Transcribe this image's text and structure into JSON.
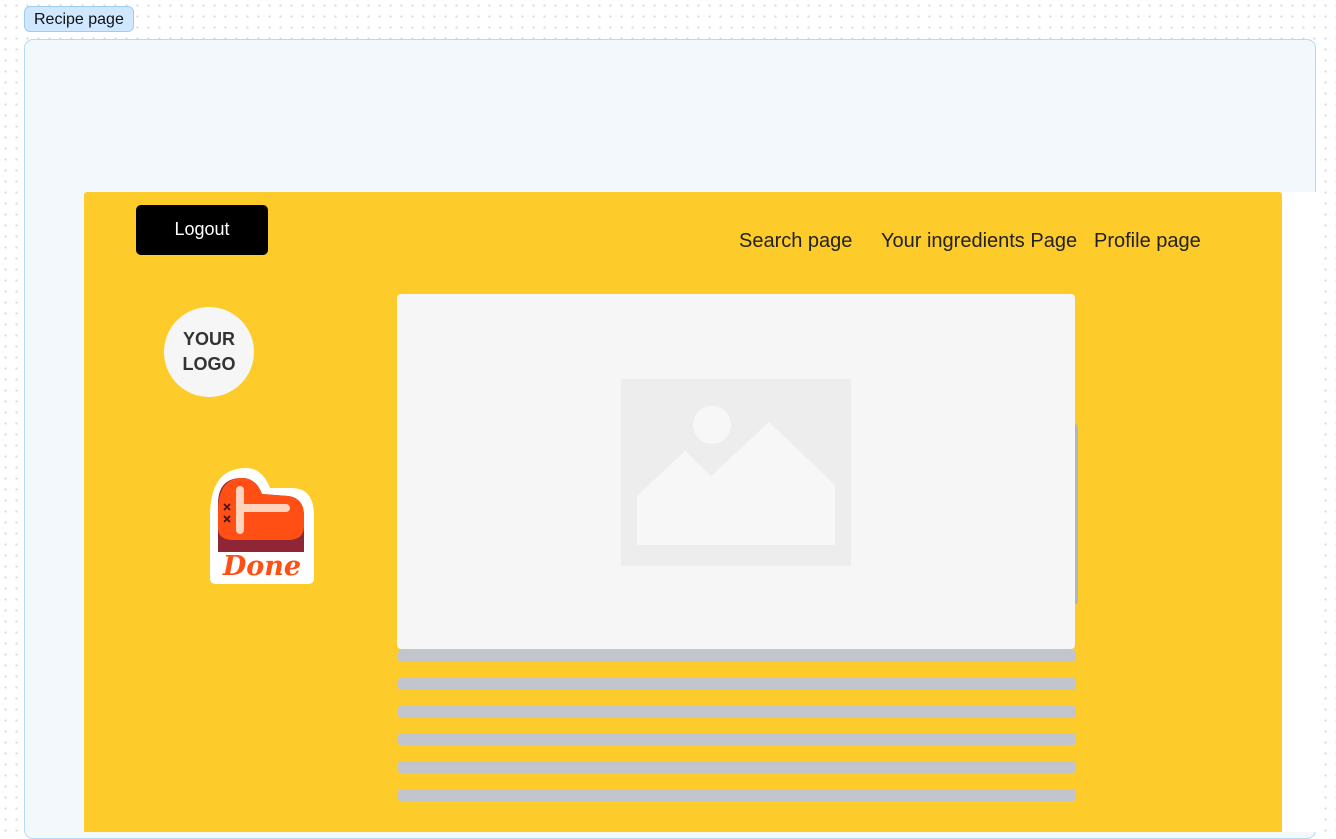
{
  "section": {
    "label": "Recipe page"
  },
  "header": {
    "logout_label": "Logout",
    "nav": [
      "Search page",
      "Your ingredients Page",
      "Profile page"
    ]
  },
  "logo": {
    "line1": "YOUR",
    "line2": "LOGO"
  },
  "sticker": {
    "text": "Done"
  },
  "icons": {
    "sticker": "done-sticker-icon",
    "image_placeholder": "image-placeholder-icon"
  },
  "colors": {
    "frame": "#fdcb2a",
    "logout_button": "#000000",
    "section_background": "#f3f8fd",
    "section_label": "#cfe7ff",
    "sticker_accent": "#ff4f14"
  }
}
